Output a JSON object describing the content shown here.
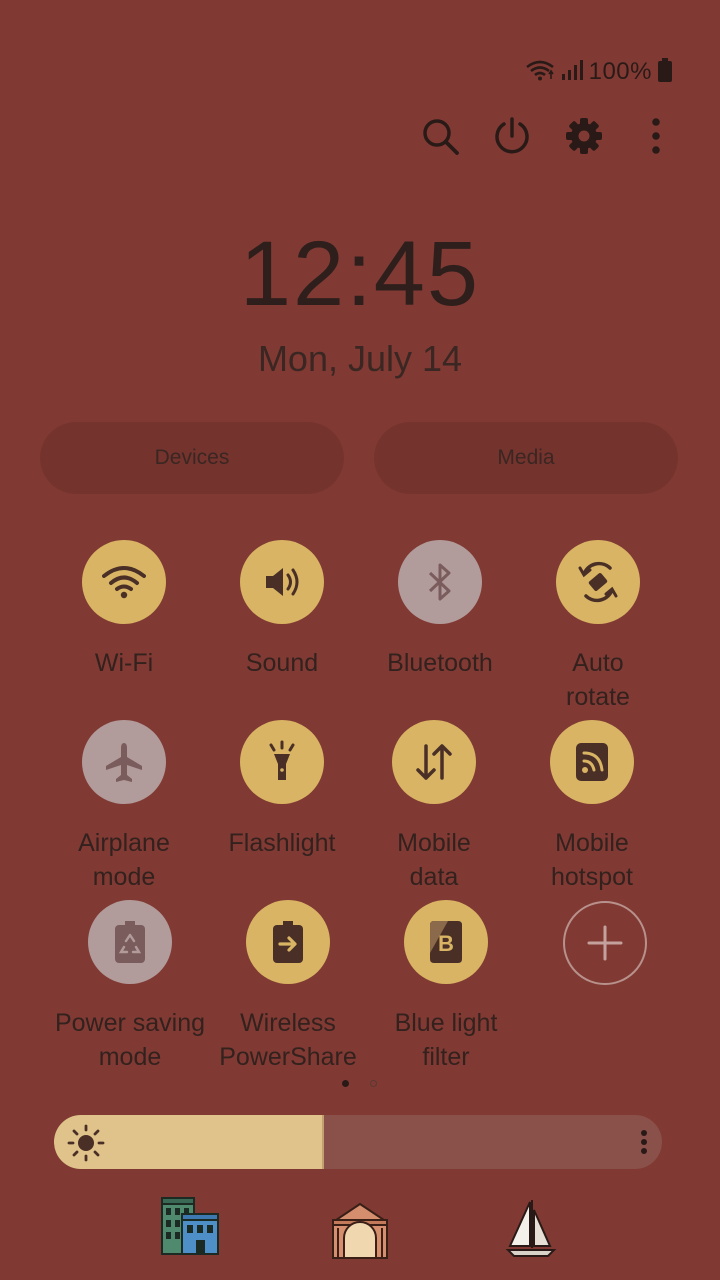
{
  "status_bar": {
    "battery_percent": "100%",
    "icons": [
      "wifi-icon",
      "signal-icon",
      "battery-icon"
    ]
  },
  "top_actions": [
    "search-icon",
    "power-icon",
    "settings-icon",
    "more-options-icon"
  ],
  "clock": {
    "time": "12:45",
    "date": "Mon, July 14"
  },
  "pills": {
    "devices": "Devices",
    "media": "Media"
  },
  "tiles": [
    {
      "label": "Wi-Fi",
      "icon": "wifi-icon",
      "state": "on"
    },
    {
      "label": "Sound",
      "icon": "sound-icon",
      "state": "on"
    },
    {
      "label": "Bluetooth",
      "icon": "bluetooth-icon",
      "state": "off"
    },
    {
      "label": "Auto\nrotate",
      "icon": "auto-rotate-icon",
      "state": "on"
    },
    {
      "label": "Airplane\nmode",
      "icon": "airplane-icon",
      "state": "off"
    },
    {
      "label": "Flashlight",
      "icon": "flashlight-icon",
      "state": "on"
    },
    {
      "label": "Mobile\ndata",
      "icon": "mobile-data-icon",
      "state": "on"
    },
    {
      "label": "Mobile\nhotspot",
      "icon": "hotspot-icon",
      "state": "on"
    },
    {
      "label": "Power saving\nmode",
      "icon": "power-saving-icon",
      "state": "off"
    },
    {
      "label": "Wireless\nPowerShare",
      "icon": "wireless-powershare-icon",
      "state": "on"
    },
    {
      "label": "Blue light\nfilter",
      "icon": "blue-light-filter-icon",
      "state": "on"
    }
  ],
  "add_tile_icon": "add-icon",
  "page_indicator": {
    "current": 1,
    "total": 2
  },
  "brightness": {
    "level": 0.44,
    "icon": "sun-icon"
  },
  "bottom_images": [
    "buildings-image",
    "arch-image",
    "sailboat-image"
  ],
  "colors": {
    "background": "#803a33",
    "tile_on": "#d8b464",
    "tile_off": "#b29b9b",
    "brightness_fill": "#dfc38a"
  }
}
